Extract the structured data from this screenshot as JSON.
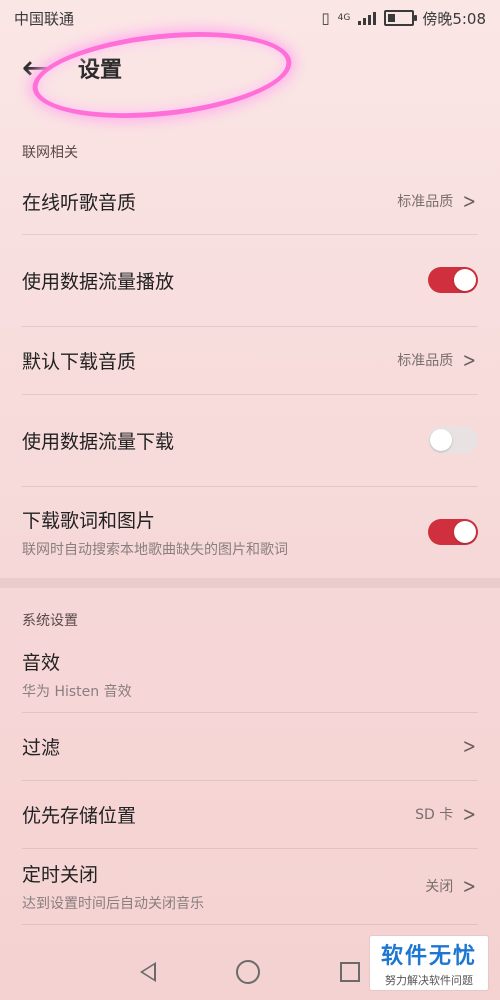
{
  "status_bar": {
    "carrier": "中国联通",
    "network": "4G",
    "time": "傍晚5:08"
  },
  "header": {
    "back_icon": "back-arrow-icon",
    "title": "设置",
    "highlight_color": "#ff6fd8"
  },
  "sections": [
    {
      "label": "联网相关",
      "rows": [
        {
          "title": "在线听歌音质",
          "value": "标准品质",
          "type": "link"
        },
        {
          "title": "使用数据流量播放",
          "type": "toggle",
          "state": "on"
        },
        {
          "title": "默认下载音质",
          "value": "标准品质",
          "type": "link"
        },
        {
          "title": "使用数据流量下载",
          "type": "toggle",
          "state": "off"
        },
        {
          "title": "下载歌词和图片",
          "subtitle": "联网时自动搜索本地歌曲缺失的图片和歌词",
          "type": "toggle",
          "state": "on"
        }
      ]
    },
    {
      "label": "系统设置",
      "rows": [
        {
          "title": "音效",
          "subtitle": "华为 Histen 音效",
          "type": "info"
        },
        {
          "title": "过滤",
          "type": "link"
        },
        {
          "title": "优先存储位置",
          "value": "SD 卡",
          "type": "link"
        },
        {
          "title": "定时关闭",
          "subtitle": "达到设置时间后自动关闭音乐",
          "value": "关闭",
          "type": "link"
        }
      ]
    }
  ],
  "colors": {
    "accent": "#d0303d",
    "background": "#f8dede"
  },
  "watermark": {
    "title": "软件无忧",
    "subtitle": "努力解决软件问题"
  }
}
